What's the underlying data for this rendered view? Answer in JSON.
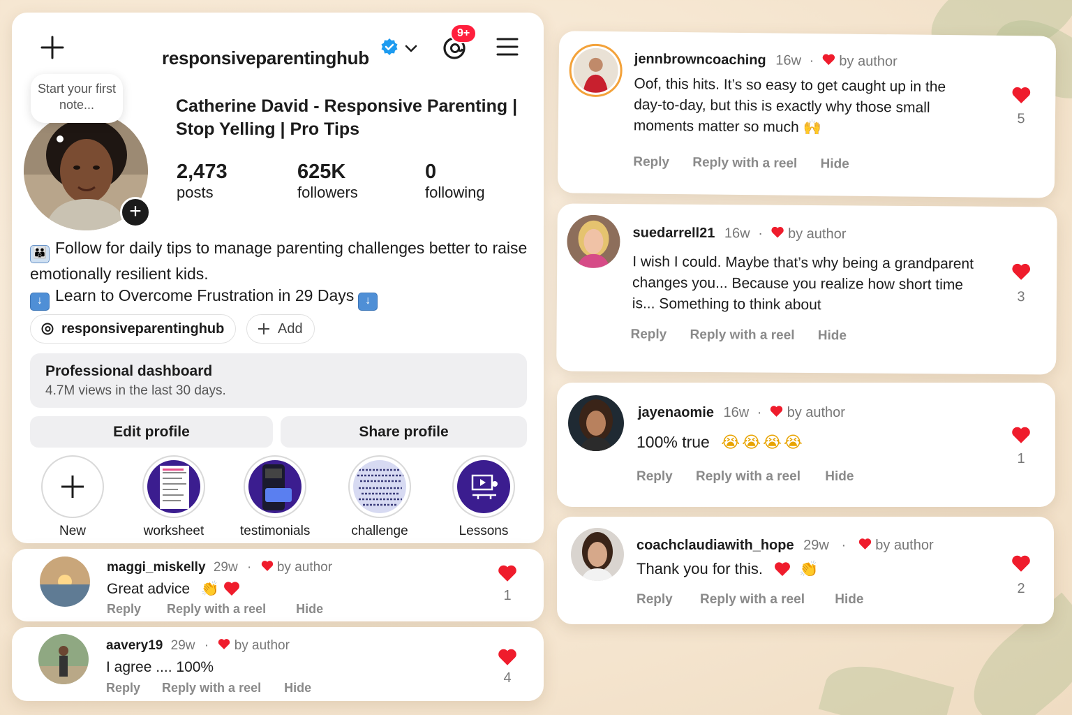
{
  "header": {
    "username": "responsiveparentinghub",
    "notification_badge": "9+"
  },
  "profile": {
    "note_placeholder": "Start your first note...",
    "display_name": "Catherine David - Responsive Parenting | Stop Yelling | Pro Tips",
    "stats": [
      {
        "value": "2,473",
        "label": "posts"
      },
      {
        "value": "625K",
        "label": "followers"
      },
      {
        "value": "0",
        "label": "following"
      }
    ],
    "bio_line1": "Follow for daily tips to manage parenting challenges better to raise emotionally resilient kids.",
    "bio_line2": "Learn to Overcome Frustration in 29 Days",
    "threads_chip": "responsiveparentinghub",
    "add_chip": "Add",
    "dashboard": {
      "title": "Professional dashboard",
      "subtitle": "4.7M views in the last 30 days."
    },
    "edit_label": "Edit profile",
    "share_label": "Share profile",
    "highlights": [
      "New",
      "worksheet",
      "testimonials",
      "challenge",
      "Lessons"
    ]
  },
  "actions": {
    "reply": "Reply",
    "reply_reel": "Reply with a reel",
    "hide": "Hide",
    "by_author": "by author"
  },
  "comments_left": [
    {
      "user": "maggi_miskelly",
      "age": "29w",
      "text": "Great advice",
      "likes": "1"
    },
    {
      "user": "aavery19",
      "age": "29w",
      "text": "I agree .... 100%",
      "likes": "4"
    }
  ],
  "comments_right": [
    {
      "user": "jennbrowncoaching",
      "age": "16w",
      "text": "Oof, this hits. It’s so easy to get caught up in the day-to-day, but this is exactly why those small moments matter so much",
      "likes": "5"
    },
    {
      "user": "suedarrell21",
      "age": "16w",
      "text": "I wish I could. Maybe that’s why being a grandparent changes you... Because you realize how short time is... Something to think about",
      "likes": "3"
    },
    {
      "user": "jayenaomie",
      "age": "16w",
      "text": "100% true",
      "likes": "1"
    },
    {
      "user": "coachclaudiawith_hope",
      "age": "29w",
      "text": "Thank you for this.",
      "likes": "2"
    }
  ],
  "colors": {
    "heart": "#ef1c2c",
    "verified": "#1d9bf0",
    "badge": "#ff1f3d",
    "story_purple": "#3b1d8f"
  }
}
